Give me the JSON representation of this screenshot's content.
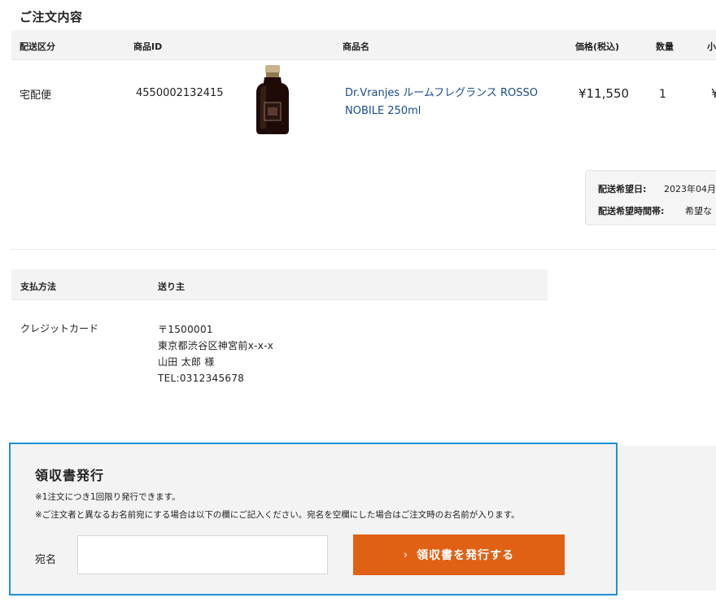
{
  "order_section": {
    "title": "ご注文内容",
    "headers": {
      "shipping_type": "配送区分",
      "product_id": "商品ID",
      "product_name": "商品名",
      "price": "価格(税込)",
      "quantity": "数量",
      "subtotal_partial": "小"
    },
    "row": {
      "shipping_type": "宅配便",
      "product_id": "4550002132415",
      "product_image_icon": "perfume-bottle-icon",
      "product_name_line1": "Dr.Vranjes ルームフレグランス ROSSO",
      "product_name_line2": "NOBILE 250ml",
      "price": "¥11,550",
      "quantity": "1",
      "subtotal_partial": "¥"
    },
    "delivery": {
      "date_label": "配送希望日:",
      "date_value_partial": "2023年04月",
      "time_label": "配送希望時間帯:",
      "time_value_partial": "希望な"
    }
  },
  "payment_section": {
    "headers": {
      "payment_method": "支払方法",
      "sender": "送り主"
    },
    "payment_method": "クレジットカード",
    "sender": {
      "postal": "〒1500001",
      "address": "東京都渋谷区神宮前x-x-x",
      "name": "山田 太郎 様",
      "tel": "TEL:0312345678"
    }
  },
  "receipt_section": {
    "title": "領収書発行",
    "note1": "※1注文につき1回限り発行できます。",
    "note2": "※ご注文者と異なるお名前宛にする場合は以下の欄にご記入ください。宛名を空欄にした場合はご注文時のお名前が入ります。",
    "addressee_label": "宛名",
    "addressee_value": "",
    "addressee_placeholder": "",
    "button_label": "領収書を発行する",
    "button_icon": "chevron-right-icon"
  },
  "colors": {
    "link": "#1a4d8c",
    "button": "#e06114",
    "panel_border": "#1e8fd6",
    "header_bg": "#f3f3f3"
  }
}
